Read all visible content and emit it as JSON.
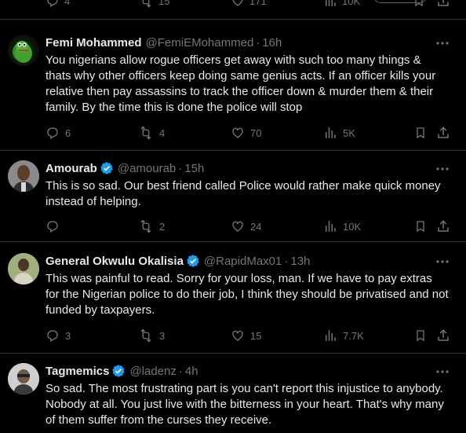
{
  "top_partial": {
    "reply_count": "4",
    "retweet_count": "15",
    "like_count": "171",
    "view_count": "10K"
  },
  "tweets": [
    {
      "name": "Femi Mohammed",
      "handle": "@FemiEMohammed",
      "time": "16h",
      "verified": false,
      "text": "You nigerians allow rogue officers get away with such too many things & thats why other officers keep doing same genius acts. If an officer kills your relative then pay assassins to track the officer down & murder them & their family. By the time this is done the police will stop",
      "replies": "6",
      "retweets": "4",
      "likes": "70",
      "views": "5K"
    },
    {
      "name": "Amourab",
      "handle": "@amourab",
      "time": "15h",
      "verified": true,
      "text": "This is so sad. Our best friend called Police would rather make quick money instead of helping.",
      "replies": "",
      "retweets": "2",
      "likes": "24",
      "views": "10K"
    },
    {
      "name": "General Okwulu Okalisia",
      "handle": "@RapidMax01",
      "time": "13h",
      "verified": true,
      "text": "This was painful to read. Sorry for your loss, man. If we have to pay extras for the Nigerian police to do their job, I think they should be privatised and not funded by taxpayers.",
      "replies": "3",
      "retweets": "3",
      "likes": "15",
      "views": "7.7K"
    },
    {
      "name": "Tagmemics",
      "handle": "@ladenz",
      "time": "4h",
      "verified": true,
      "text": "So sad. The most frustrating part is you can't report this injustice to anybody. Nobody at all. You just live with the bitterness in your heart. That's why many of them suffer from the curses they receive.",
      "replies": "",
      "retweets": "",
      "likes": "",
      "views": ""
    }
  ],
  "dot_separator": "·",
  "colors": {
    "background": "#000000",
    "text": "#e7e9ea",
    "muted": "#71767b",
    "divider": "#2f3336",
    "verified": "#1d9bf0"
  }
}
